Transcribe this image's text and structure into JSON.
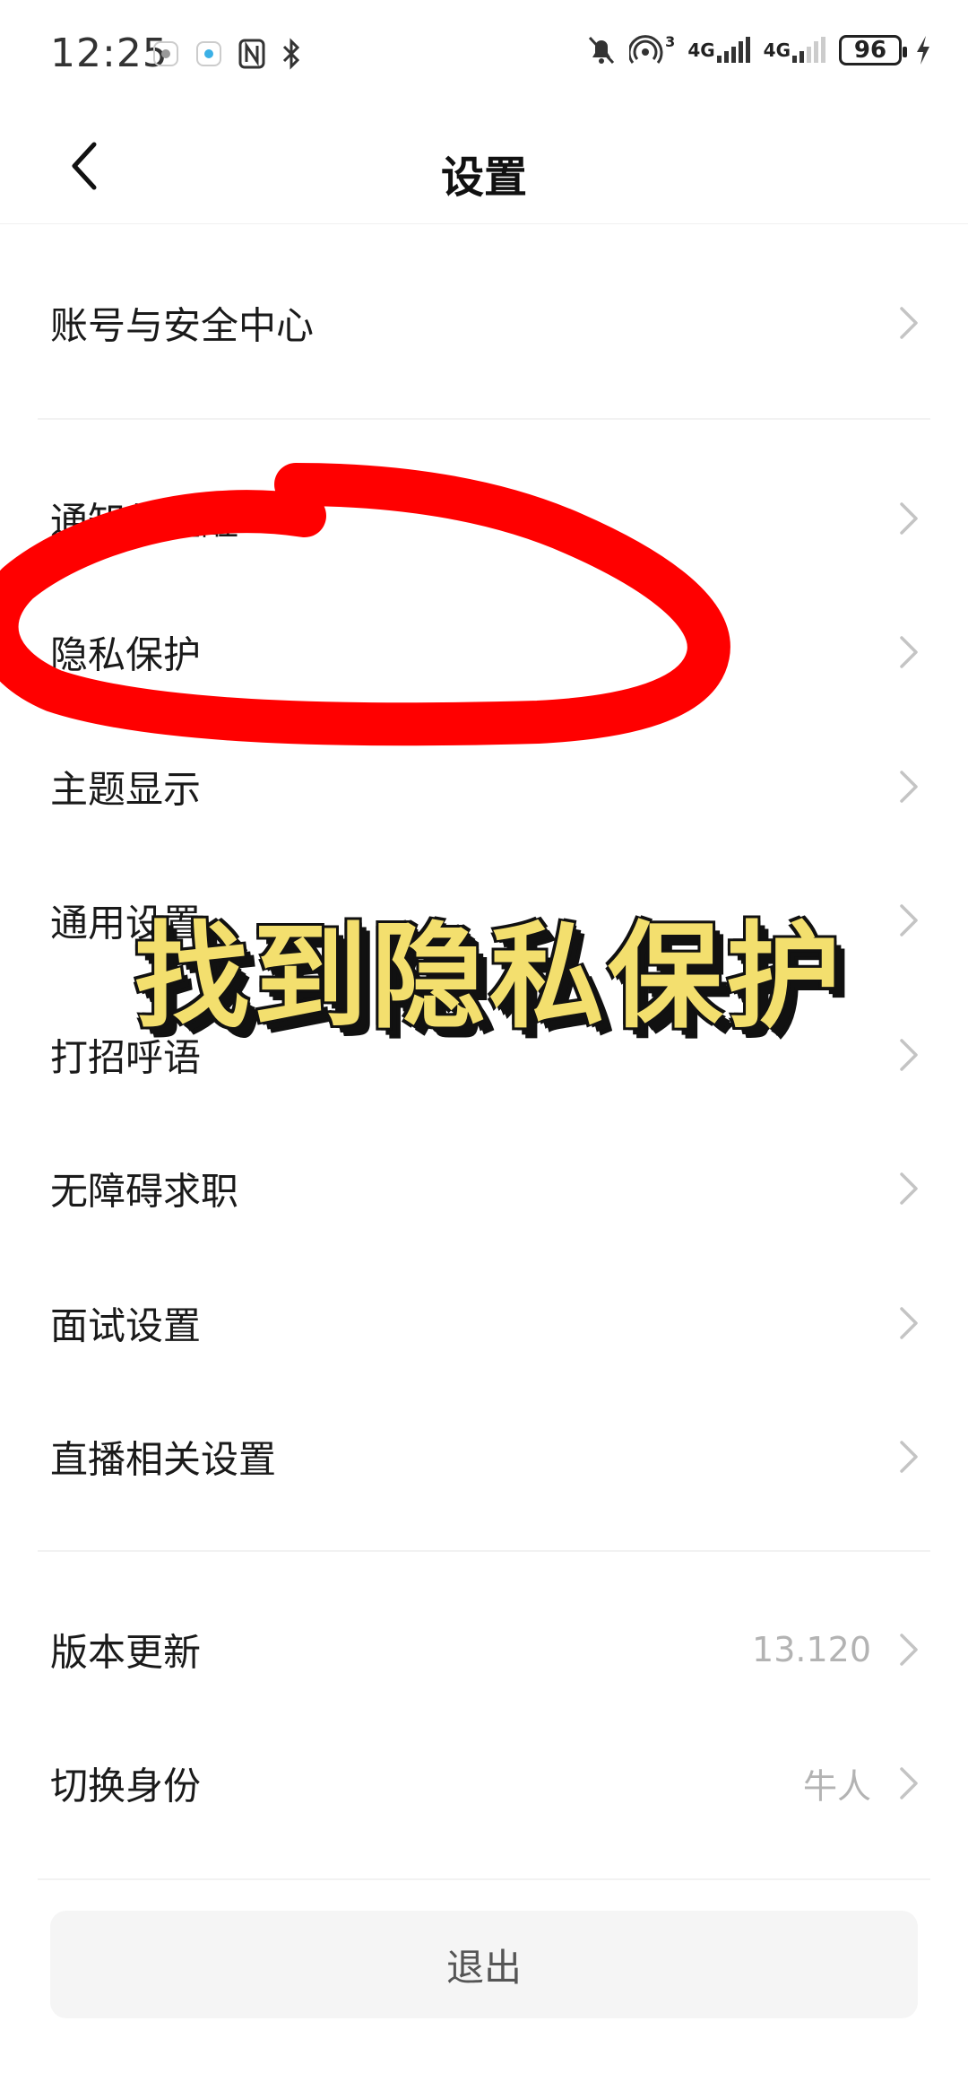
{
  "status_bar": {
    "time": "12:25",
    "battery": "96",
    "network1": "4G",
    "network2": "4G",
    "hotspot_badge": "3"
  },
  "header": {
    "title": "设置"
  },
  "items": [
    {
      "label": "账号与安全中心",
      "value": ""
    },
    {
      "label": "通知与提醒",
      "value": ""
    },
    {
      "label": "隐私保护",
      "value": ""
    },
    {
      "label": "主题显示",
      "value": ""
    },
    {
      "label": "通用设置",
      "value": ""
    },
    {
      "label": "打招呼语",
      "value": ""
    },
    {
      "label": "无障碍求职",
      "value": ""
    },
    {
      "label": "面试设置",
      "value": ""
    },
    {
      "label": "直播相关设置",
      "value": ""
    },
    {
      "label": "版本更新",
      "value": "13.120"
    },
    {
      "label": "切换身份",
      "value": "牛人"
    }
  ],
  "logout_label": "退出",
  "annotation": {
    "caption": "找到隐私保护",
    "highlight_color": "#ff0000"
  },
  "colors": {
    "caption_fill": "#f3df6e",
    "secondary_text": "#b3b3b3"
  }
}
